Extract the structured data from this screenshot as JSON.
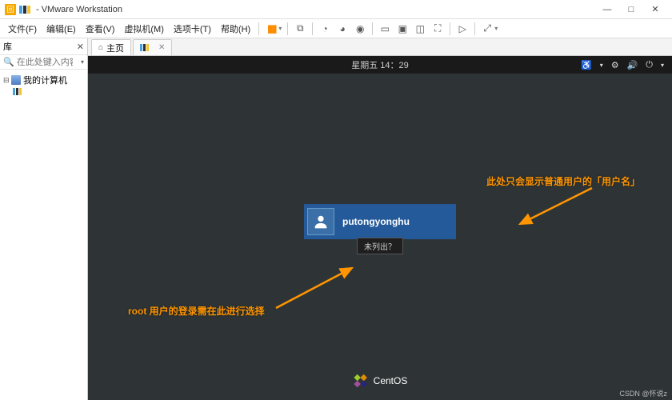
{
  "window": {
    "title": "- VMware Workstation",
    "controls": {
      "min": "—",
      "max": "□",
      "close": "✕"
    }
  },
  "menu": {
    "file": "文件(F)",
    "edit": "编辑(E)",
    "view": "查看(V)",
    "vm": "虚拟机(M)",
    "tabs": "选项卡(T)",
    "help": "帮助(H)"
  },
  "sidebar": {
    "title": "库",
    "search_placeholder": "在此处键入内容...",
    "root": "我的计算机",
    "vm_item": " "
  },
  "tabs": {
    "home": "主页",
    "vm": " "
  },
  "guest": {
    "datetime": "星期五 14：29",
    "username": "putongyonghu",
    "not_listed": "未列出？",
    "brand": "CentOS"
  },
  "annotations": {
    "top": "此处只会显示普通用户的「用户名」",
    "bottom": "root 用户的登录需在此进行选择"
  },
  "watermark": "CSDN @怀说z"
}
